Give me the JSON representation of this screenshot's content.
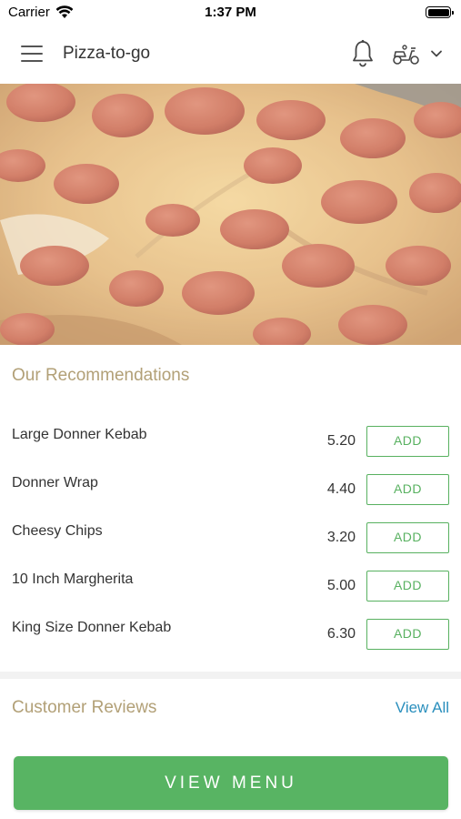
{
  "status_bar": {
    "carrier": "Carrier",
    "time": "1:37 PM"
  },
  "navbar": {
    "title": "Pizza-to-go",
    "icons": [
      "menu-icon",
      "bell-icon",
      "scooter-icon",
      "chevron-down-icon"
    ]
  },
  "hero": {
    "image": "pepperoni-pizza-photo"
  },
  "recommendations": {
    "title": "Our Recommendations",
    "items": [
      {
        "name": "Large Donner Kebab",
        "price": "5.20",
        "action": "ADD"
      },
      {
        "name": "Donner Wrap",
        "price": "4.40",
        "action": "ADD"
      },
      {
        "name": "Cheesy Chips",
        "price": "3.20",
        "action": "ADD"
      },
      {
        "name": "10 Inch Margherita",
        "price": "5.00",
        "action": "ADD"
      },
      {
        "name": "King Size Donner Kebab",
        "price": "6.30",
        "action": "ADD"
      }
    ]
  },
  "reviews": {
    "title": "Customer Reviews",
    "view_all": "View All"
  },
  "footer": {
    "view_menu": "VIEW MENU"
  },
  "colors": {
    "accent_green": "#58b463",
    "section_title": "#b2a077",
    "link_blue": "#2a8fbd"
  }
}
